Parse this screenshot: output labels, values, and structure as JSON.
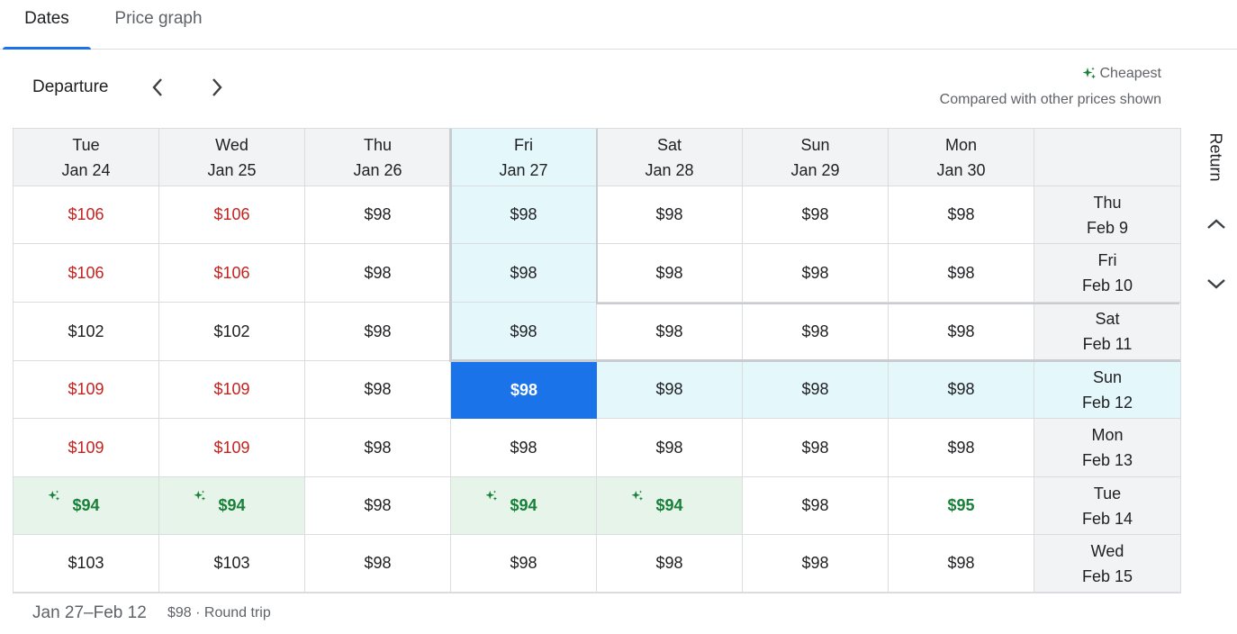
{
  "tabs": [
    {
      "label": "Dates",
      "active": true
    },
    {
      "label": "Price graph",
      "active": false
    }
  ],
  "header": {
    "departure_label": "Departure",
    "cheapest_label": "Cheapest",
    "compared_text": "Compared with other prices shown"
  },
  "return_label": "Return",
  "colors": {
    "accent": "#1a73e8",
    "expensive": "#c5221f",
    "cheap": "#188038",
    "selected_highlight": "#e4f7fb",
    "cheap_bg": "#e6f4ea"
  },
  "departure_dates": [
    {
      "day": "Tue",
      "date": "Jan 24"
    },
    {
      "day": "Wed",
      "date": "Jan 25"
    },
    {
      "day": "Thu",
      "date": "Jan 26"
    },
    {
      "day": "Fri",
      "date": "Jan 27"
    },
    {
      "day": "Sat",
      "date": "Jan 28"
    },
    {
      "day": "Sun",
      "date": "Jan 29"
    },
    {
      "day": "Mon",
      "date": "Jan 30"
    }
  ],
  "return_dates": [
    {
      "day": "Thu",
      "date": "Feb 9"
    },
    {
      "day": "Fri",
      "date": "Feb 10"
    },
    {
      "day": "Sat",
      "date": "Feb 11"
    },
    {
      "day": "Sun",
      "date": "Feb 12"
    },
    {
      "day": "Mon",
      "date": "Feb 13"
    },
    {
      "day": "Tue",
      "date": "Feb 14"
    },
    {
      "day": "Wed",
      "date": "Feb 15"
    }
  ],
  "prices": [
    [
      {
        "v": "$106",
        "t": "red"
      },
      {
        "v": "$106",
        "t": "red"
      },
      {
        "v": "$98"
      },
      {
        "v": "$98"
      },
      {
        "v": "$98"
      },
      {
        "v": "$98"
      },
      {
        "v": "$98"
      }
    ],
    [
      {
        "v": "$106",
        "t": "red"
      },
      {
        "v": "$106",
        "t": "red"
      },
      {
        "v": "$98"
      },
      {
        "v": "$98"
      },
      {
        "v": "$98"
      },
      {
        "v": "$98"
      },
      {
        "v": "$98"
      }
    ],
    [
      {
        "v": "$102"
      },
      {
        "v": "$102"
      },
      {
        "v": "$98"
      },
      {
        "v": "$98"
      },
      {
        "v": "$98"
      },
      {
        "v": "$98"
      },
      {
        "v": "$98"
      }
    ],
    [
      {
        "v": "$109",
        "t": "red"
      },
      {
        "v": "$109",
        "t": "red"
      },
      {
        "v": "$98"
      },
      {
        "v": "$98"
      },
      {
        "v": "$98"
      },
      {
        "v": "$98"
      },
      {
        "v": "$98"
      }
    ],
    [
      {
        "v": "$109",
        "t": "red"
      },
      {
        "v": "$109",
        "t": "red"
      },
      {
        "v": "$98"
      },
      {
        "v": "$98"
      },
      {
        "v": "$98"
      },
      {
        "v": "$98"
      },
      {
        "v": "$98"
      }
    ],
    [
      {
        "v": "$94",
        "t": "cheapest"
      },
      {
        "v": "$94",
        "t": "cheapest"
      },
      {
        "v": "$98"
      },
      {
        "v": "$94",
        "t": "cheapest"
      },
      {
        "v": "$94",
        "t": "cheapest"
      },
      {
        "v": "$98"
      },
      {
        "v": "$95",
        "t": "green"
      }
    ],
    [
      {
        "v": "$103"
      },
      {
        "v": "$103"
      },
      {
        "v": "$98"
      },
      {
        "v": "$98"
      },
      {
        "v": "$98"
      },
      {
        "v": "$98"
      },
      {
        "v": "$98"
      }
    ]
  ],
  "selected": {
    "departure_index": 3,
    "return_index": 3
  },
  "footer": {
    "dates": "Jan 27–Feb 12",
    "info": "$98 · Round trip"
  }
}
